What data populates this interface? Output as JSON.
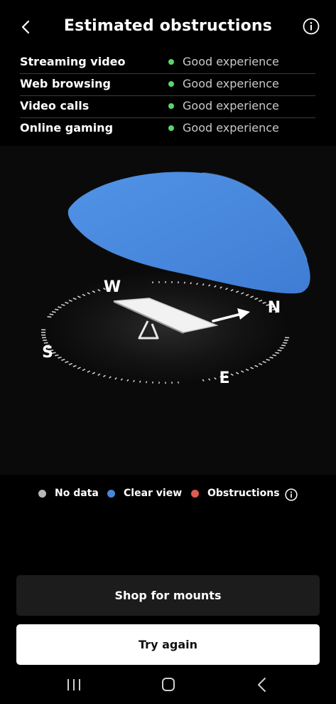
{
  "header": {
    "title": "Estimated obstructions"
  },
  "metrics": [
    {
      "label": "Streaming video",
      "status": "Good experience"
    },
    {
      "label": "Web browsing",
      "status": "Good experience"
    },
    {
      "label": "Video calls",
      "status": "Good experience"
    },
    {
      "label": "Online gaming",
      "status": "Good experience"
    }
  ],
  "compass": {
    "north": "N",
    "south": "S",
    "east": "E",
    "west": "W"
  },
  "legend": {
    "no_data": {
      "label": "No data",
      "color": "#b8b8b8"
    },
    "clear_view": {
      "label": "Clear view",
      "color": "#4a86d8"
    },
    "obstructions": {
      "label": "Obstructions",
      "color": "#e05a4e"
    }
  },
  "colors": {
    "status_good": "#5bd46a",
    "sky_dome": "#4a86d8"
  },
  "buttons": {
    "shop": "Shop for mounts",
    "try_again": "Try again"
  },
  "icons": {
    "back": "chevron-left-icon",
    "info": "info-icon",
    "nav_recents": "recents-icon",
    "nav_home": "home-icon",
    "nav_back": "back-icon"
  }
}
